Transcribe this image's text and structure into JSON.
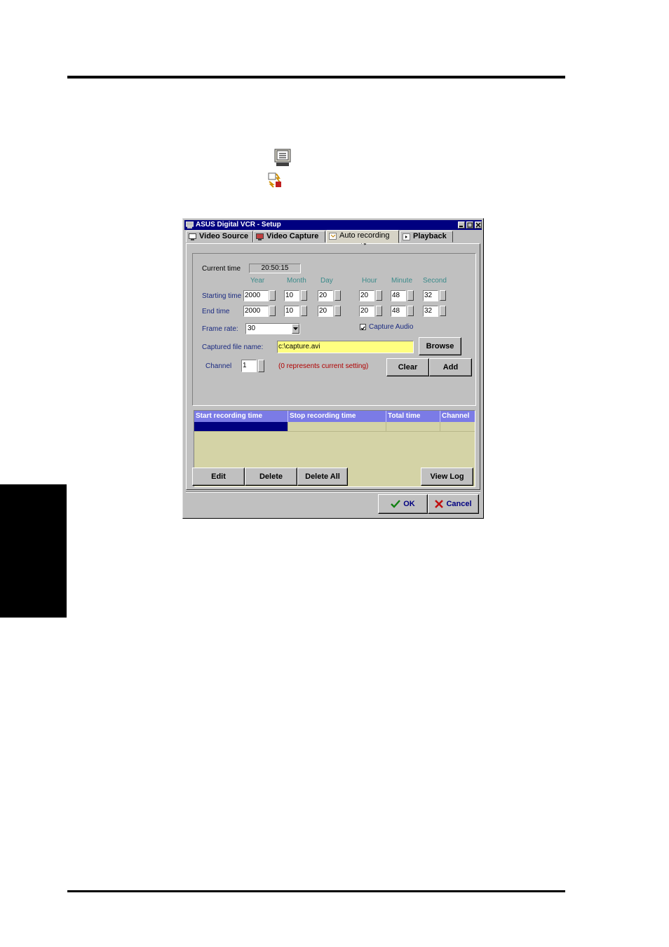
{
  "window": {
    "title": "ASUS Digital VCR - Setup",
    "tabs": [
      {
        "label": "Video Source",
        "icon": "monitor-icon"
      },
      {
        "label": "Video Capture",
        "icon": "capture-icon"
      },
      {
        "label": "Auto recording",
        "icon": "clock-icon"
      },
      {
        "label": "Playback",
        "icon": "play-icon"
      }
    ],
    "active_tab": "Auto recording"
  },
  "auto_recording": {
    "current_time_label": "Current time",
    "current_time_value": "20:50:15",
    "col_headers": [
      "Year",
      "Month",
      "Day",
      "Hour",
      "Minute",
      "Second"
    ],
    "starting_time": {
      "label": "Starting time",
      "values": [
        "2000",
        "10",
        "20",
        "20",
        "48",
        "32"
      ]
    },
    "end_time": {
      "label": "End time",
      "values": [
        "2000",
        "10",
        "20",
        "20",
        "48",
        "32"
      ]
    },
    "frame_rate": {
      "label": "Frame rate:",
      "value": "30"
    },
    "capture_audio": {
      "label": "Capture Audio",
      "checked": true
    },
    "captured_file": {
      "label": "Captured file name:",
      "value": "c:\\capture.avi"
    },
    "browse_label": "Browse",
    "channel": {
      "label": "Channel",
      "value": "1",
      "note": "(0 represents current setting)"
    },
    "clear_label": "Clear",
    "add_label": "Add"
  },
  "schedule_table": {
    "columns": [
      "Start recording time",
      "Stop recording time",
      "Total time",
      "Channel"
    ]
  },
  "actions": {
    "edit": "Edit",
    "delete": "Delete",
    "delete_all": "Delete All",
    "view_log": "View Log",
    "ok": "OK",
    "cancel": "Cancel"
  }
}
